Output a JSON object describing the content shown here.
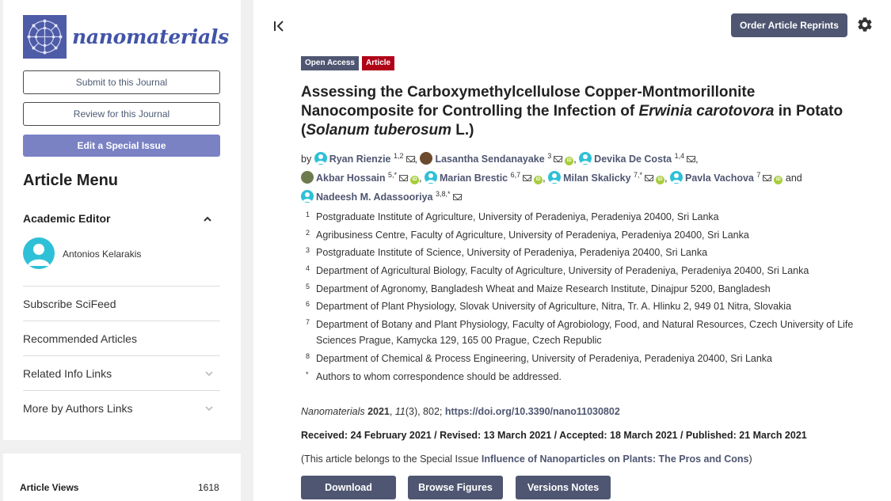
{
  "sidebar": {
    "journal_name": "nanomaterials",
    "submit_label": "Submit to this Journal",
    "review_label": "Review for this Journal",
    "special_issue_label": "Edit a Special Issue",
    "menu_title": "Article Menu",
    "academic_editor_label": "Academic Editor",
    "editor_name": "Antonios Kelarakis",
    "links": [
      "Subscribe SciFeed",
      "Recommended Articles",
      "Related Info Links",
      "More by Authors Links"
    ],
    "views_label": "Article Views",
    "views_count": "1618"
  },
  "header": {
    "reprints_label": "Order Article Reprints"
  },
  "article": {
    "badge_open_access": "Open Access",
    "badge_type": "Article",
    "title_part1": "Assessing the Carboxymethylcellulose Copper-Montmorillonite Nanocomposite for Controlling the Infection of ",
    "title_italic1": "Erwinia carotovora",
    "title_part2": " in Potato (",
    "title_italic2": "Solanum tuberosum",
    "title_part3": " L.)",
    "by": "by",
    "and": "and",
    "authors": [
      {
        "name": "Ryan Rienzie",
        "sup": "1,2"
      },
      {
        "name": "Lasantha Sendanayake",
        "sup": "3"
      },
      {
        "name": "Devika De Costa",
        "sup": "1,4"
      },
      {
        "name": "Akbar Hossain",
        "sup": "5,*"
      },
      {
        "name": "Marian Brestic",
        "sup": "6,7"
      },
      {
        "name": "Milan Skalicky",
        "sup": "7,*"
      },
      {
        "name": "Pavla Vachova",
        "sup": "7"
      },
      {
        "name": "Nadeesh M. Adassooriya",
        "sup": "3,8,*"
      }
    ],
    "affiliations": [
      {
        "num": "1",
        "text": "Postgraduate Institute of Agriculture, University of Peradeniya, Peradeniya 20400, Sri Lanka"
      },
      {
        "num": "2",
        "text": "Agribusiness Centre, Faculty of Agriculture, University of Peradeniya, Peradeniya 20400, Sri Lanka"
      },
      {
        "num": "3",
        "text": "Postgraduate Institute of Science, University of Peradeniya, Peradeniya 20400, Sri Lanka"
      },
      {
        "num": "4",
        "text": "Department of Agricultural Biology, Faculty of Agriculture, University of Peradeniya, Peradeniya 20400, Sri Lanka"
      },
      {
        "num": "5",
        "text": "Department of Agronomy, Bangladesh Wheat and Maize Research Institute, Dinajpur 5200, Bangladesh"
      },
      {
        "num": "6",
        "text": "Department of Plant Physiology, Slovak University of Agriculture, Nitra, Tr. A. Hlinku 2, 949 01 Nitra, Slovakia"
      },
      {
        "num": "7",
        "text": "Department of Botany and Plant Physiology, Faculty of Agrobiology, Food, and Natural Resources, Czech University of Life Sciences Prague, Kamycka 129, 165 00 Prague, Czech Republic"
      },
      {
        "num": "8",
        "text": "Department of Chemical & Process Engineering, University of Peradeniya, Peradeniya 20400, Sri Lanka"
      },
      {
        "num": "*",
        "text": "Authors to whom correspondence should be addressed."
      }
    ],
    "citation_journal": "Nanomaterials",
    "citation_year": "2021",
    "citation_volume": "11",
    "citation_rest": "(3), 802; ",
    "doi": "https://doi.org/10.3390/nano11030802",
    "dates": "Received: 24 February 2021 / Revised: 13 March 2021 / Accepted: 18 March 2021 / Published: 21 March 2021",
    "special_prefix": "(This article belongs to the Special Issue ",
    "special_issue": "Influence of Nanoparticles on Plants: The Pros and Cons",
    "special_suffix": ")"
  },
  "actions": {
    "download": "Download",
    "browse_figures": "Browse Figures",
    "versions_notes": "Versions Notes"
  },
  "colors": {
    "primary": "#4f5671",
    "accent": "#7a82c4",
    "article_badge": "#b00318",
    "avatar": "#2ec0d6",
    "orcid": "#a6ce39"
  }
}
